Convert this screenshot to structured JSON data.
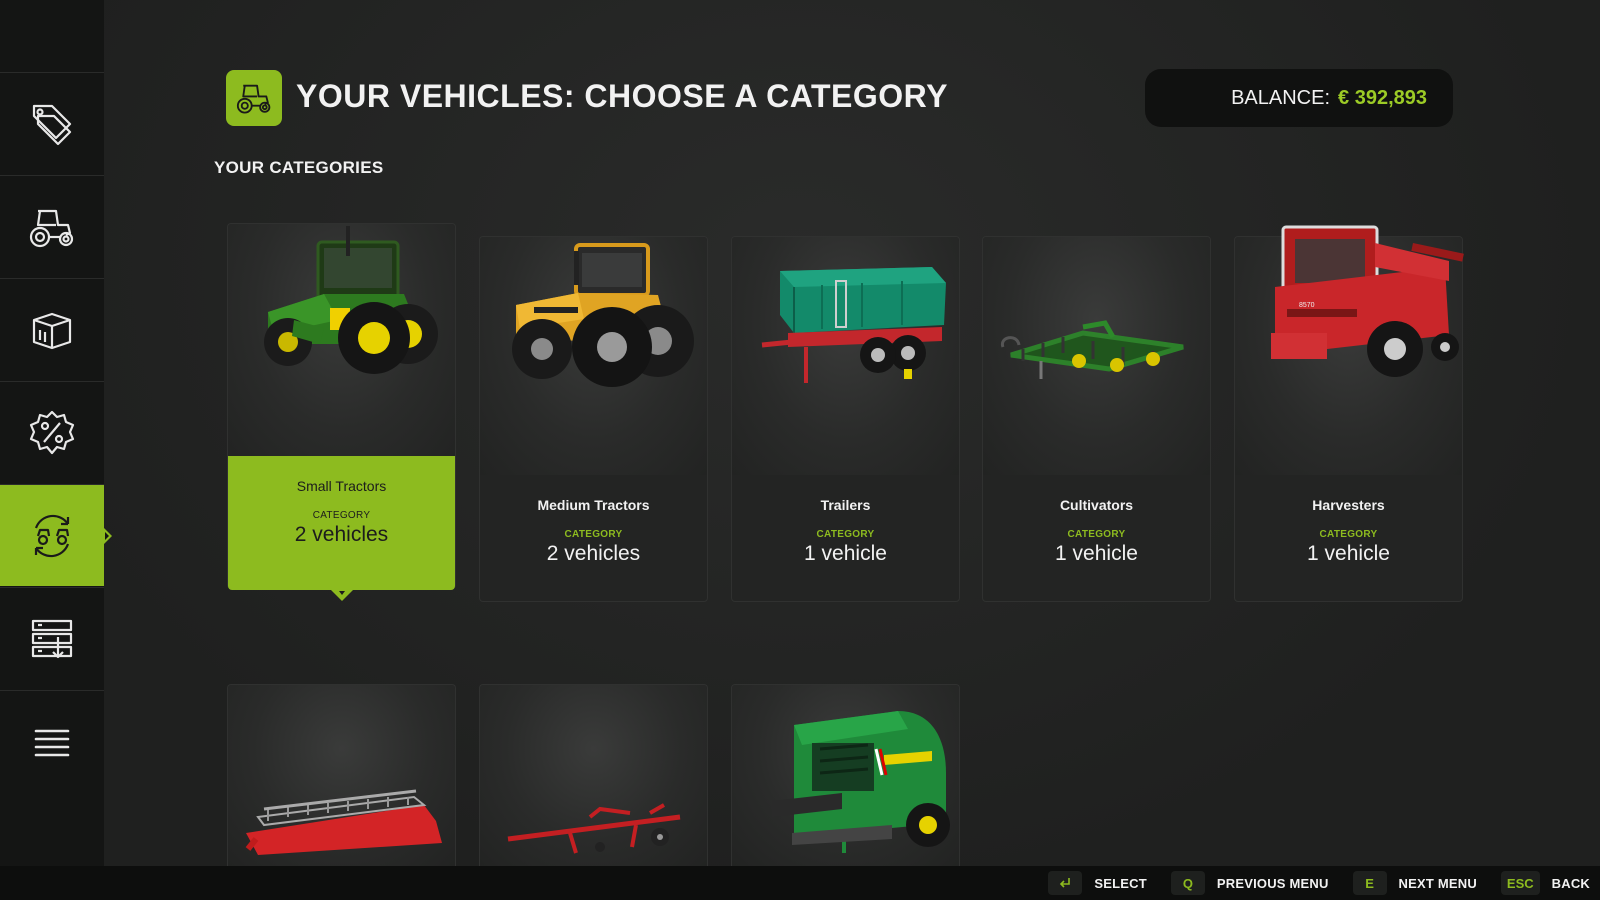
{
  "header": {
    "title": "YOUR VEHICLES: CHOOSE A CATEGORY",
    "title_icon": "tractor-icon",
    "balance_label": "BALANCE:",
    "balance_value": "€ 392,893"
  },
  "section_title": "YOUR CATEGORIES",
  "sidebar": {
    "items": [
      {
        "icon": "price-tags-icon",
        "active": false
      },
      {
        "icon": "tractor-icon",
        "active": false
      },
      {
        "icon": "crate-icon",
        "active": false
      },
      {
        "icon": "discount-badge-icon",
        "active": false
      },
      {
        "icon": "vehicle-cycle-icon",
        "active": true
      },
      {
        "icon": "storage-rack-icon",
        "active": false
      },
      {
        "icon": "list-menu-icon",
        "active": false
      }
    ]
  },
  "categories": [
    {
      "name": "Small Tractors",
      "category_label": "CATEGORY",
      "count": "2 vehicles",
      "selected": true,
      "image": "green-tractor"
    },
    {
      "name": "Medium Tractors",
      "category_label": "CATEGORY",
      "count": "2 vehicles",
      "selected": false,
      "image": "yellow-tractor"
    },
    {
      "name": "Trailers",
      "category_label": "CATEGORY",
      "count": "1 vehicle",
      "selected": false,
      "image": "teal-trailer"
    },
    {
      "name": "Cultivators",
      "category_label": "CATEGORY",
      "count": "1 vehicle",
      "selected": false,
      "image": "green-cultivator"
    },
    {
      "name": "Harvesters",
      "category_label": "CATEGORY",
      "count": "1 vehicle",
      "selected": false,
      "image": "red-harvester"
    },
    {
      "image": "red-header"
    },
    {
      "image": "red-header-trailer"
    },
    {
      "image": "green-baler"
    }
  ],
  "footer": {
    "hints": [
      {
        "key": "",
        "key_icon": "enter-icon",
        "label": "SELECT"
      },
      {
        "key": "Q",
        "label": "PREVIOUS MENU"
      },
      {
        "key": "E",
        "label": "NEXT MENU"
      },
      {
        "key": "ESC",
        "label": "BACK"
      }
    ]
  },
  "colors": {
    "accent": "#8dbb1f",
    "balance_value": "#9ccb26",
    "background": "#222322",
    "sidebar": "#141514"
  }
}
